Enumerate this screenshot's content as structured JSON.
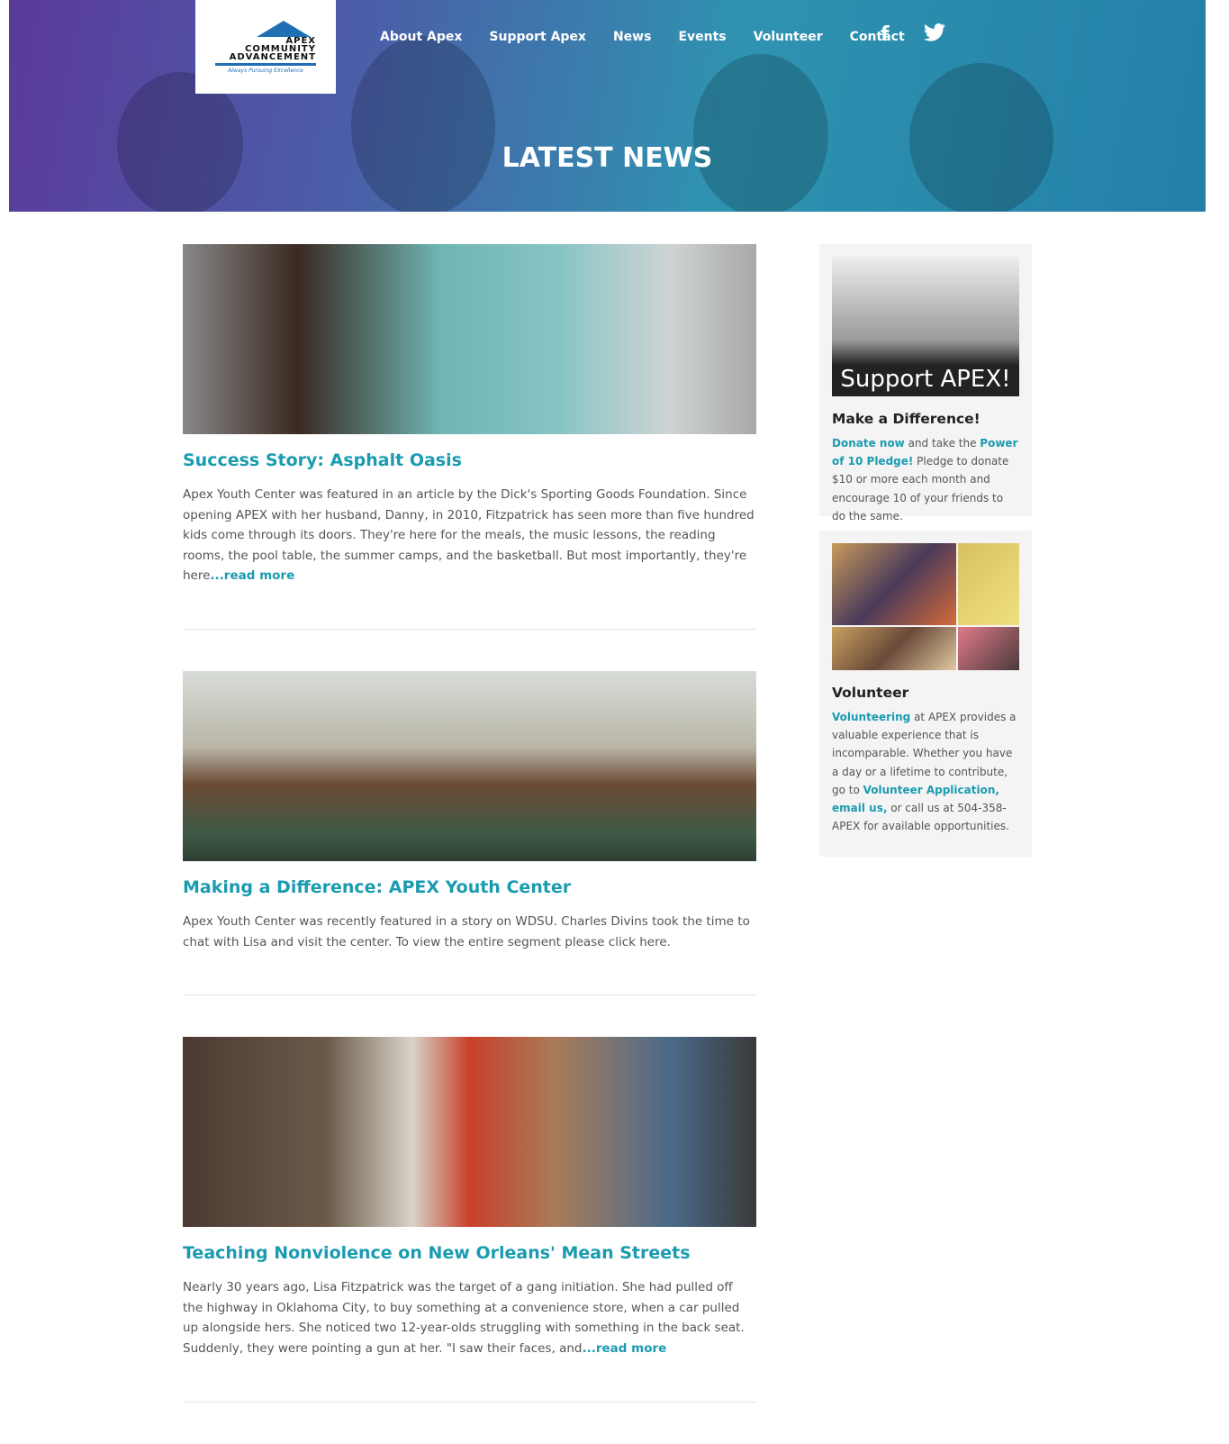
{
  "header": {
    "logo_text": [
      "APEX",
      "COMMUNITY",
      "ADVANCEMENT",
      "Always Pursuing EXcellence"
    ],
    "nav": [
      "About Apex",
      "Support Apex",
      "News",
      "Events",
      "Volunteer",
      "Contact"
    ],
    "social": {
      "facebook": "facebook-icon",
      "twitter": "twitter-icon"
    },
    "title": "LATEST NEWS"
  },
  "articles": [
    {
      "title": "Success Story: Asphalt Oasis",
      "body": "Apex Youth Center was featured in an article by the Dick's Sporting Goods Foundation. Since opening APEX with her husband, Danny, in 2010, Fitzpatrick has seen more than five hundred kids come through its doors. They're here for the meals, the music lessons, the reading rooms, the pool table, the summer camps, and the basketball. But most importantly, they're here",
      "more": "...read more"
    },
    {
      "title": "Making a Difference: APEX Youth Center",
      "body": "Apex Youth Center was recently featured in a story on WDSU. Charles Divins took the time to chat with Lisa and visit the center. To view the entire segment please click here.",
      "more": ""
    },
    {
      "title": "Teaching Nonviolence on New Orleans' Mean Streets",
      "body": "Nearly 30 years ago, Lisa Fitzpatrick was the target of a gang initiation. She had pulled off the highway in Oklahoma City, to buy something at a convenience store, when a car pulled up alongside hers. She noticed two 12-year-olds struggling with something in the back seat. Suddenly, they were pointing a gun at her. \"I saw their faces, and",
      "more": "...read more"
    }
  ],
  "sidebar": {
    "support": {
      "image_text": "Support APEX!",
      "title": "Make a Difference!",
      "link1": "Donate now",
      "t1": " and take the ",
      "link2": "Power of 10 Pledge!",
      "t2": " Pledge to donate $10 or more each month and encourage 10 of your friends to do the same."
    },
    "volunteer": {
      "title": "Volunteer",
      "link1": "Volunteering",
      "t1": " at APEX provides a valuable experience that is incomparable. Whether you have a day or a lifetime to contribute, go to ",
      "link2": "Volunteer Application,",
      "link3": "email us,",
      "t2": " or call us at 504-358-APEX for available opportunities."
    }
  },
  "colors": {
    "accent": "#1a9bb0"
  }
}
